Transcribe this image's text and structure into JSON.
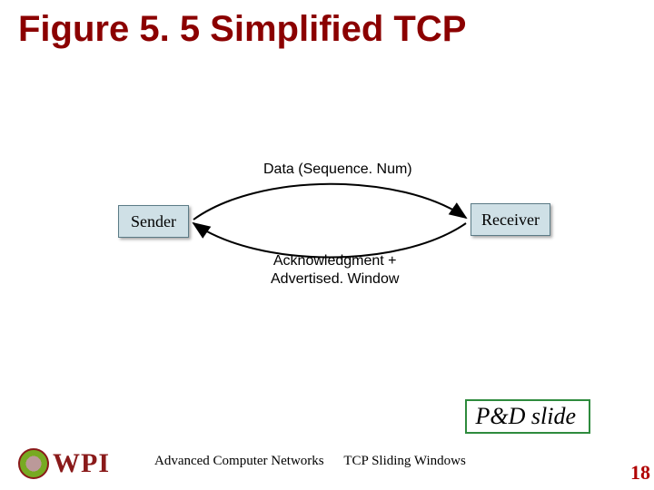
{
  "title": "Figure 5. 5 Simplified TCP",
  "diagram": {
    "sender_label": "Sender",
    "receiver_label": "Receiver",
    "top_label": "Data (Sequence. Num)",
    "bottom_label_line1": "Acknowledgment +",
    "bottom_label_line2": "Advertised. Window"
  },
  "pnd_box": "P&D slide",
  "footer": {
    "course": "Advanced Computer Networks",
    "topic": "TCP Sliding Windows"
  },
  "page_number": "18",
  "logo_text": "WPI"
}
